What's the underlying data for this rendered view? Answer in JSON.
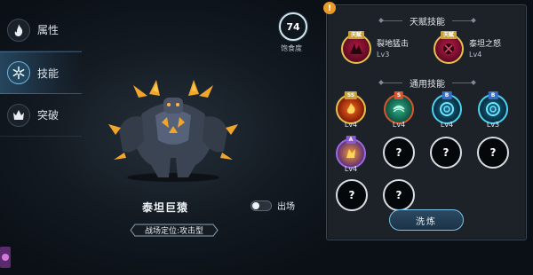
{
  "sidebar": {
    "items": [
      {
        "label": "属性",
        "icon": "fire-icon"
      },
      {
        "label": "技能",
        "icon": "snowflake-icon"
      },
      {
        "label": "突破",
        "icon": "crown-icon"
      }
    ],
    "active_index": 1
  },
  "satiety": {
    "value": "74",
    "label": "饱食度"
  },
  "hero": {
    "name": "泰坦巨猿",
    "deploy_label": "出场",
    "deployed": false,
    "role": "战场定位:攻击型"
  },
  "panel": {
    "info_icon": "!",
    "talent_title": "天赋技能",
    "talents": [
      {
        "badge": "天赋",
        "name": "裂地猛击",
        "level": "Lv3"
      },
      {
        "badge": "天赋",
        "name": "泰坦之怒",
        "level": "Lv4"
      }
    ],
    "general_title": "通用技能",
    "skills": [
      {
        "tier": "SS",
        "level": "Lv4",
        "tier_color": "#c9a23a"
      },
      {
        "tier": "S",
        "level": "Lv4",
        "tier_color": "#d9552d"
      },
      {
        "tier": "B",
        "level": "Lv4",
        "tier_color": "#3a6fc9"
      },
      {
        "tier": "B",
        "level": "Lv3",
        "tier_color": "#3a6fc9"
      },
      {
        "tier": "A",
        "level": "Lv4",
        "tier_color": "#8a5bd1"
      }
    ],
    "locked_symbol": "?",
    "wash_button": "洗炼"
  },
  "colors": {
    "accent": "#7cc2ea",
    "gold": "#e7c14e",
    "info": "#e99a28"
  }
}
